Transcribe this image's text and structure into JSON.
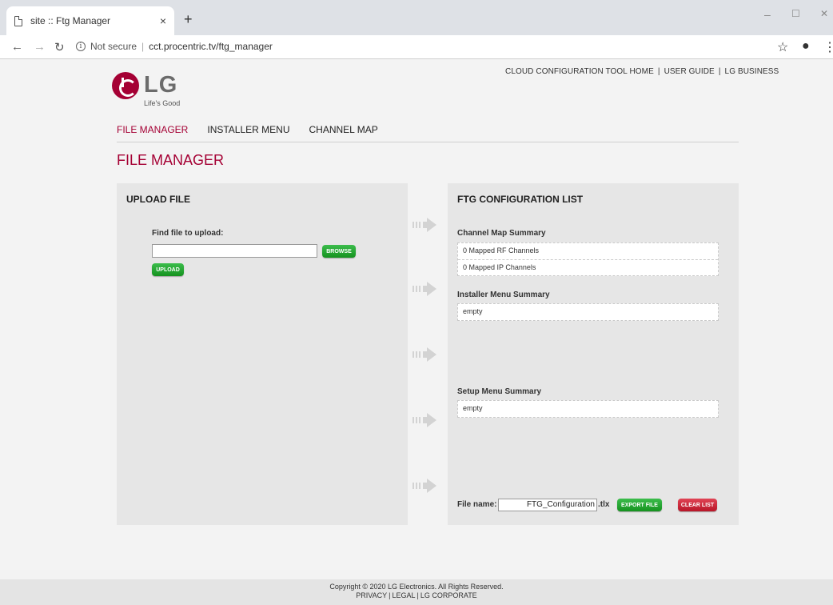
{
  "browser": {
    "tab_title": "site :: Ftg Manager",
    "tab_close": "×",
    "new_tab": "+",
    "security": "Not secure",
    "url": "cct.procentric.tv/ftg_manager",
    "win_min": "–",
    "win_max": "☐",
    "win_close": "✕"
  },
  "header": {
    "links": [
      "CLOUD CONFIGURATION TOOL HOME",
      "USER GUIDE",
      "LG BUSINESS"
    ],
    "logo_text": "LG",
    "tagline": "Life's Good"
  },
  "nav": {
    "items": [
      "FILE MANAGER",
      "INSTALLER MENU",
      "CHANNEL MAP"
    ],
    "active": "FILE MANAGER"
  },
  "page_title": "FILE MANAGER",
  "upload": {
    "title": "UPLOAD FILE",
    "find_label": "Find file to upload:",
    "file_value": "",
    "browse_label": "BROWSE",
    "upload_label": "UPLOAD"
  },
  "config": {
    "title": "FTG CONFIGURATION LIST",
    "channel_map": {
      "title": "Channel Map Summary",
      "rows": [
        "0 Mapped RF Channels",
        "0 Mapped IP Channels"
      ]
    },
    "installer_menu": {
      "title": "Installer Menu Summary",
      "value": "empty"
    },
    "setup_menu": {
      "title": "Setup Menu Summary",
      "value": "empty"
    },
    "file_name_label": "File name:",
    "file_name_value": "FTG_Configuration",
    "file_ext": ".tlx",
    "export_label": "EXPORT FILE",
    "clear_label": "CLEAR LIST"
  },
  "footer": {
    "copyright": "Copyright © 2020 LG Electronics. All Rights Reserved.",
    "links": [
      "PRIVACY",
      "LEGAL",
      "LG CORPORATE"
    ]
  },
  "colors": {
    "brand": "#a50034",
    "button_green": "#1a9a28",
    "button_red": "#c31a2f",
    "panel": "#e6e6e6"
  }
}
